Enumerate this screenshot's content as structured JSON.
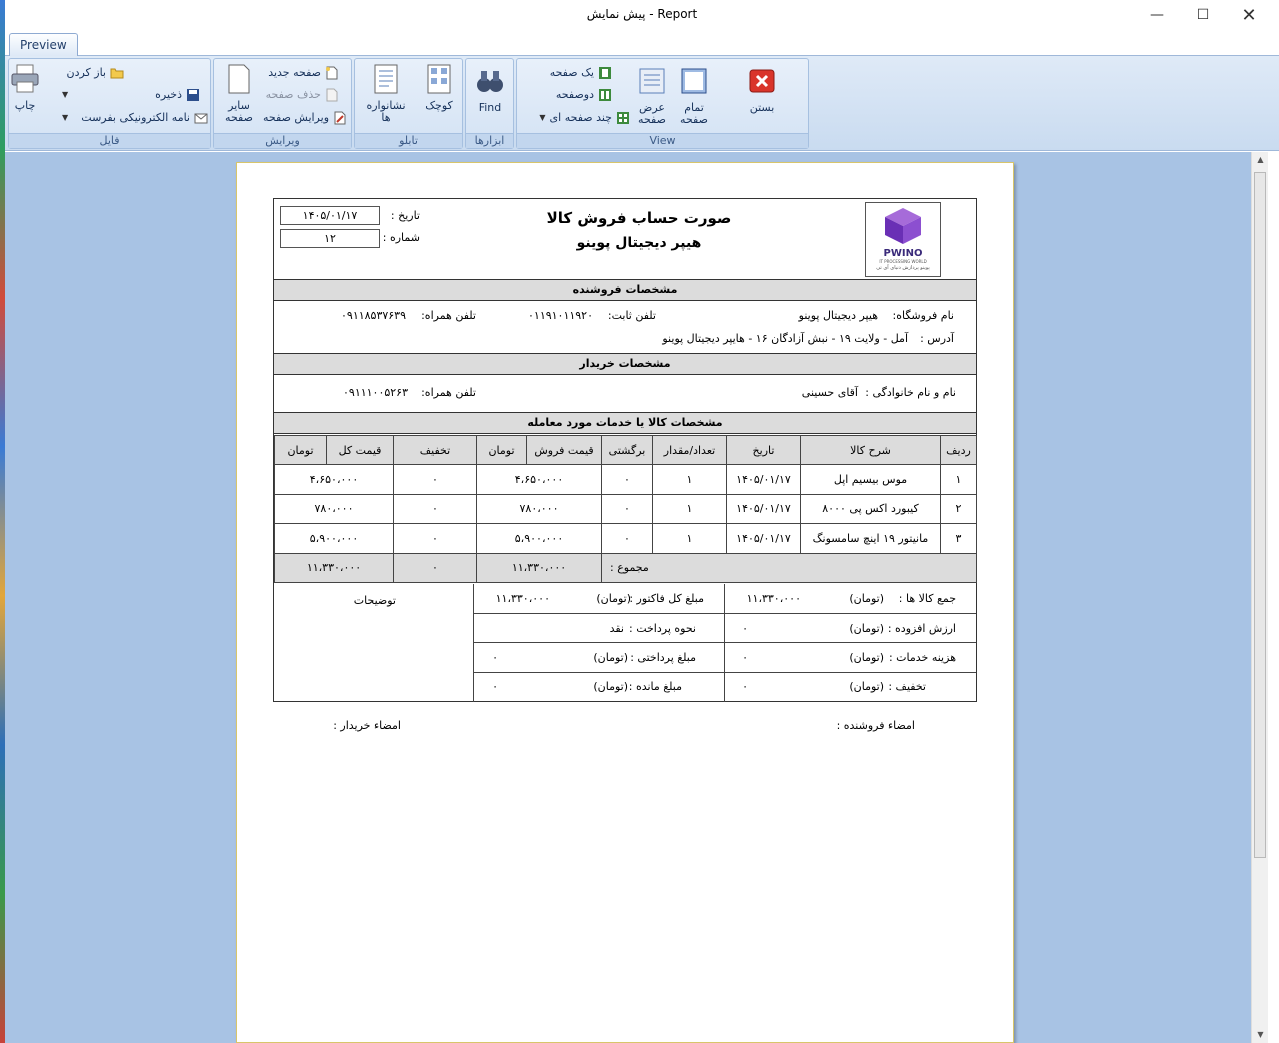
{
  "window": {
    "title": "پیش نمایش - Report"
  },
  "ribbon": {
    "tab": "Preview",
    "groups": {
      "file": {
        "caption": "فایل",
        "print": "چاپ",
        "open": "باز کردن",
        "save": "ذخیره",
        "email": "نامه الکترونیکی بفرست"
      },
      "edit": {
        "caption": "ویرایش",
        "other_pages": "سایر صفحه",
        "new_page": "صفحه جدید",
        "delete_page": "حذف صفحه",
        "edit_page": "ویرایش صفحه"
      },
      "nav": {
        "caption": "تابلو",
        "bookmarks": "نشانواره ها",
        "thumbnails": "کوچک"
      },
      "tools": {
        "caption": "ابزارها",
        "find": "Find"
      },
      "view": {
        "caption": "View",
        "one_page": "یک صفحه",
        "two_pages": "دوصفحه",
        "multi_page": "چند صفحه ای",
        "page_width": "عرض صفحه",
        "full_page": "تمام صفحه"
      },
      "close": {
        "label": "بستن"
      }
    }
  },
  "report": {
    "title": "صورت حساب فروش کالا",
    "store_name": "هیپر دیجیتال پوینو",
    "logo": {
      "brand": "PWINO",
      "tag": "IT PROCESSING WORLD",
      "fa": "پوینو پردازش دنیای آی تی"
    },
    "date_label": "تاریخ :",
    "date_value": "۱۴۰۵/۰۱/۱۷",
    "number_label": "شماره :",
    "number_value": "۱۲",
    "seller_band": "مشخصات فروشنده",
    "seller": {
      "store_label": "نام فروشگاه:",
      "store_value": "هیپر دیجیتال پوینو",
      "landline_label": "تلفن ثابت:",
      "landline_value": "۰۱۱۹۱۰۱۱۹۲۰",
      "mobile_label": "تلفن همراه:",
      "mobile_value": "۰۹۱۱۸۵۳۷۶۳۹",
      "address_label": "آدرس :",
      "address_value": "آمل - ولایت ۱۹ - نبش آزادگان ۱۶ - هایپر دیجیتال پوینو"
    },
    "buyer_band": "مشخصات خریدار",
    "buyer": {
      "name_label": "نام و نام خانوادگی :",
      "name_value": "آقای حسینی",
      "mobile_label": "تلفن همراه:",
      "mobile_value": "۰۹۱۱۱۰۰۵۲۶۳"
    },
    "items_band": "مشخصات کالا یا خدمات مورد معامله",
    "columns": [
      "ردیف",
      "شرح کالا",
      "تاریخ",
      "تعداد/مقدار",
      "برگشتی",
      "قیمت فروش",
      "تومان",
      "تخفیف",
      "قیمت کل",
      "تومان"
    ],
    "rows": [
      [
        "۱",
        "موس بیسیم اپل",
        "۱۴۰۵/۰۱/۱۷",
        "۱",
        "۰",
        "۴،۶۵۰،۰۰۰",
        "",
        "۰",
        "۴،۶۵۰،۰۰۰",
        ""
      ],
      [
        "۲",
        "کیبورد اکس پی ۸۰۰۰",
        "۱۴۰۵/۰۱/۱۷",
        "۱",
        "۰",
        "۷۸۰،۰۰۰",
        "",
        "۰",
        "۷۸۰،۰۰۰",
        ""
      ],
      [
        "۳",
        "مانیتور ۱۹ اینچ سامسونگ",
        "۱۴۰۵/۰۱/۱۷",
        "۱",
        "۰",
        "۵،۹۰۰،۰۰۰",
        "",
        "۰",
        "۵،۹۰۰،۰۰۰",
        ""
      ]
    ],
    "total": {
      "label": "مجموع :",
      "sale_total": "۱۱،۳۳۰،۰۰۰",
      "discount_total": "۰",
      "grand_total": "۱۱،۳۳۰،۰۰۰"
    },
    "summary": {
      "goods_total_label": "جمع کالا ها :",
      "goods_total_unit": "(تومان)",
      "goods_total_value": "۱۱،۳۳۰،۰۰۰",
      "vat_label": "ارزش افزوده :",
      "vat_unit": "(تومان)",
      "vat_value": "۰",
      "service_label": "هزینه خدمات :",
      "service_unit": "(تومان)",
      "service_value": "۰",
      "discount_label": "تخفیف :",
      "discount_unit": "(تومان)",
      "discount_value": "۰",
      "invoice_total_label": "مبلغ کل فاکتور :",
      "invoice_total_unit": "(تومان)",
      "invoice_total_value": "۱۱،۳۳۰،۰۰۰",
      "payment_label": "نحوه پرداخت :",
      "payment_value": "نقد",
      "paid_label": "مبلغ پرداختی :",
      "paid_unit": "(تومان)",
      "paid_value": "۰",
      "remaining_label": "مبلغ مانده :",
      "remaining_unit": "(تومان)",
      "remaining_value": "۰",
      "notes_label": "توضیحات"
    },
    "signature_seller": "امضاء فروشنده :",
    "signature_buyer": "امضاء خریدار :"
  }
}
